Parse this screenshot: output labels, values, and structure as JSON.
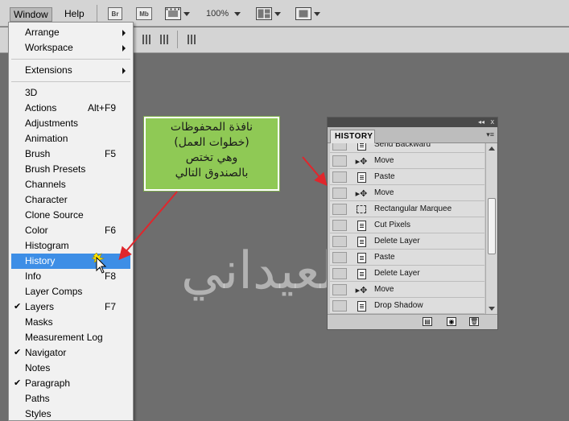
{
  "menubar": {
    "items": [
      "Window",
      "Help"
    ],
    "toolbar": {
      "bridge": "Br",
      "minibridge": "Mb",
      "zoom": "100%"
    }
  },
  "dropdown": {
    "group1": [
      {
        "label": "Arrange",
        "submenu": true
      },
      {
        "label": "Workspace",
        "submenu": true
      }
    ],
    "group2": [
      {
        "label": "Extensions",
        "submenu": true
      }
    ],
    "group3": [
      {
        "label": "3D",
        "shortcut": "",
        "checked": false
      },
      {
        "label": "Actions",
        "shortcut": "Alt+F9",
        "checked": false
      },
      {
        "label": "Adjustments",
        "shortcut": "",
        "checked": false
      },
      {
        "label": "Animation",
        "shortcut": "",
        "checked": false
      },
      {
        "label": "Brush",
        "shortcut": "F5",
        "checked": false
      },
      {
        "label": "Brush Presets",
        "shortcut": "",
        "checked": false
      },
      {
        "label": "Channels",
        "shortcut": "",
        "checked": false
      },
      {
        "label": "Character",
        "shortcut": "",
        "checked": false
      },
      {
        "label": "Clone Source",
        "shortcut": "",
        "checked": false
      },
      {
        "label": "Color",
        "shortcut": "F6",
        "checked": false
      },
      {
        "label": "Histogram",
        "shortcut": "",
        "checked": false
      },
      {
        "label": "History",
        "shortcut": "",
        "checked": false,
        "selected": true
      },
      {
        "label": "Info",
        "shortcut": "F8",
        "checked": false
      },
      {
        "label": "Layer Comps",
        "shortcut": "",
        "checked": false
      },
      {
        "label": "Layers",
        "shortcut": "F7",
        "checked": true
      },
      {
        "label": "Masks",
        "shortcut": "",
        "checked": false
      },
      {
        "label": "Measurement Log",
        "shortcut": "",
        "checked": false
      },
      {
        "label": "Navigator",
        "shortcut": "",
        "checked": true
      },
      {
        "label": "Notes",
        "shortcut": "",
        "checked": false
      },
      {
        "label": "Paragraph",
        "shortcut": "",
        "checked": true
      },
      {
        "label": "Paths",
        "shortcut": "",
        "checked": false
      },
      {
        "label": "Styles",
        "shortcut": "",
        "checked": false
      }
    ],
    "check_mark": "✔"
  },
  "callout": {
    "lines": [
      "نافذة المحفوظات",
      "(خطوات العمل)",
      "وهي تختص",
      "بالصندوق التالي"
    ],
    "color": "#8fc955"
  },
  "history_panel": {
    "tab_label": "HISTORY",
    "rows": [
      {
        "label": "Send Backward",
        "icon": "doc-icon"
      },
      {
        "label": "Move",
        "icon": "move-icon"
      },
      {
        "label": "Paste",
        "icon": "doc-icon"
      },
      {
        "label": "Move",
        "icon": "move-icon"
      },
      {
        "label": "Rectangular Marquee",
        "icon": "marquee-icon"
      },
      {
        "label": "Cut Pixels",
        "icon": "doc-icon"
      },
      {
        "label": "Delete Layer",
        "icon": "doc-icon"
      },
      {
        "label": "Paste",
        "icon": "doc-icon"
      },
      {
        "label": "Delete Layer",
        "icon": "doc-icon"
      },
      {
        "label": "Move",
        "icon": "move-icon"
      },
      {
        "label": "Drop Shadow",
        "icon": "doc-icon"
      }
    ]
  },
  "watermark": {
    "text": "سمير العيداني"
  },
  "colors": {
    "accent_selected": "#3d8ee6",
    "arrow": "#e0262c"
  }
}
